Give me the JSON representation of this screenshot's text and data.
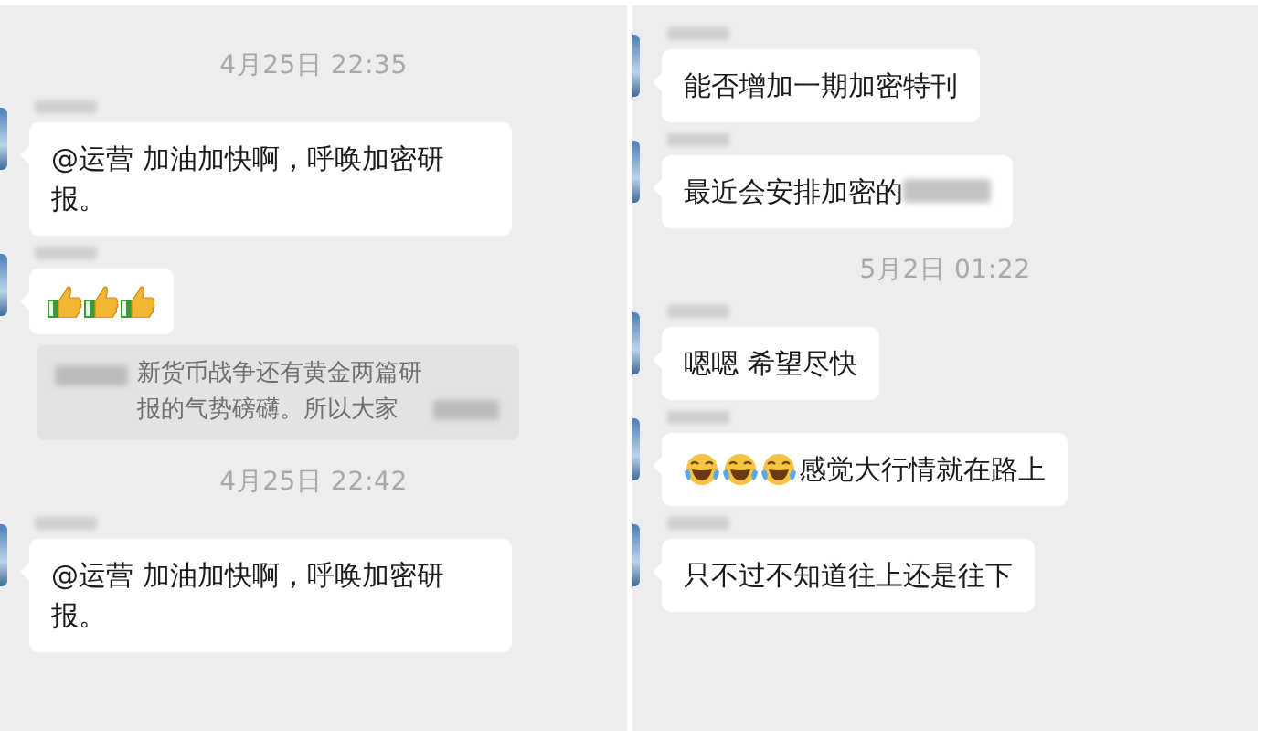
{
  "panels": [
    {
      "items": [
        {
          "kind": "time",
          "text": "4月25日 22:35"
        },
        {
          "kind": "text",
          "text": "@运营 加油加快啊，呼唤加密研报。",
          "redacted_tail": false
        },
        {
          "kind": "thumbs"
        },
        {
          "kind": "quote",
          "text": "新货币战争还有黄金两篇研报的气势磅礴。所以大家",
          "redacted_head": true,
          "redacted_tail": true
        },
        {
          "kind": "time",
          "text": "4月25日 22:42"
        },
        {
          "kind": "text",
          "text": "@运营 加油加快啊，呼唤加密研报。",
          "redacted_tail": false
        }
      ]
    },
    {
      "items": [
        {
          "kind": "text",
          "text": "能否增加一期加密特刊",
          "redacted_tail": false
        },
        {
          "kind": "text",
          "text": "最近会安排加密的",
          "redacted_tail": true
        },
        {
          "kind": "time",
          "text": "5月2日 01:22"
        },
        {
          "kind": "text",
          "text": "嗯嗯 希望尽快",
          "redacted_tail": false
        },
        {
          "kind": "laugh",
          "text": "感觉大行情就在路上"
        },
        {
          "kind": "text",
          "text": "只不过不知道往上还是往下",
          "redacted_tail": false
        }
      ]
    }
  ]
}
